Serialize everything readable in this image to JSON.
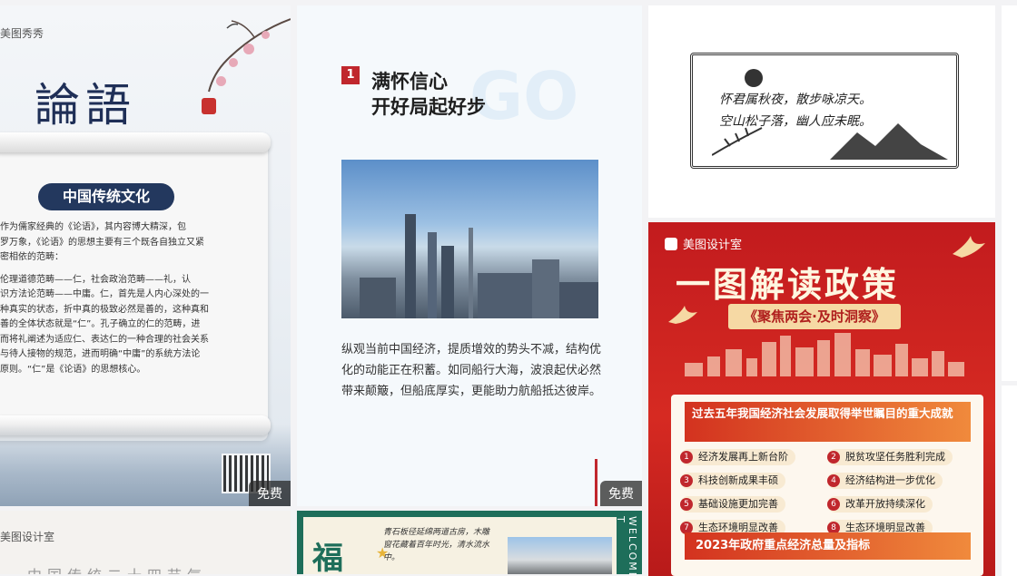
{
  "card1": {
    "brand": "美图秀秀",
    "title": "論語",
    "badge": "中国传统文化",
    "paragraphs": [
      "作为儒家经典的《论语》，其内容博大精深，包",
      "罗万象，《论语》的思想主要有三个既各自独立又紧",
      "密相依的范畴：",
      "伦理道德范畴——仁，社会政治范畴——礼，认",
      "识方法论范畴——中庸。仁，首先是人内心深处的一",
      "种真实的状态，折中真的极致必然是善的，这种真和",
      "善的全体状态就是“仁”。孔子确立的仁的范畴，进",
      "而将礼阐述为适应仁、表达仁的一种合理的社会关系",
      "与待人接物的规范，进而明确“中庸”的系统方法论",
      "原则。“仁”是《论语》的思想核心。"
    ],
    "free_label": "免费"
  },
  "card2": {
    "number": "1",
    "headline_line1": "满怀信心",
    "headline_line2": "开好局起好步",
    "watermark": "GO",
    "body": "纵观当前中国经济，提质增效的势头不减，结构优化的动能正在积蓄。如同船行大海，波浪起伏必然带来颠簸，但船底厚实，更能助力航船抵达彼岸。",
    "free_label": "免费"
  },
  "card3": {
    "poem_line1": "怀君属秋夜，散步咏凉天。",
    "poem_line2": "空山松子落，幽人应未眠。"
  },
  "card4": {
    "brand": "美图设计室",
    "title": "一图解读政策",
    "subtitle": "《聚焦两会·及时洞察》",
    "panel_header": "过去五年我国经济社会发展取得举世瞩目的重大成就",
    "items": [
      {
        "n": "1",
        "label": "经济发展再上新台阶"
      },
      {
        "n": "2",
        "label": "脱贫攻坚任务胜利完成"
      },
      {
        "n": "3",
        "label": "科技创新成果丰硕"
      },
      {
        "n": "4",
        "label": "经济结构进一步优化"
      },
      {
        "n": "5",
        "label": "基础设施更加完善"
      },
      {
        "n": "6",
        "label": "改革开放持续深化"
      },
      {
        "n": "7",
        "label": "生态环境明显改善"
      },
      {
        "n": "8",
        "label": "生态环境明显改善"
      }
    ],
    "panel_footer": "2023年政府重点经济总量及指标"
  },
  "card5": {
    "brand": "美图设计室",
    "title": "中国传统二十四节气"
  },
  "card6": {
    "big_char": "福",
    "welcome": "WELCOME T",
    "handwriting": "青石板径延绵两道古房，木雕窗花藏着百年时光，清水流水中。"
  },
  "colors": {
    "accent_red": "#c0272d",
    "navy": "#23385e",
    "green": "#1e6e5a"
  }
}
